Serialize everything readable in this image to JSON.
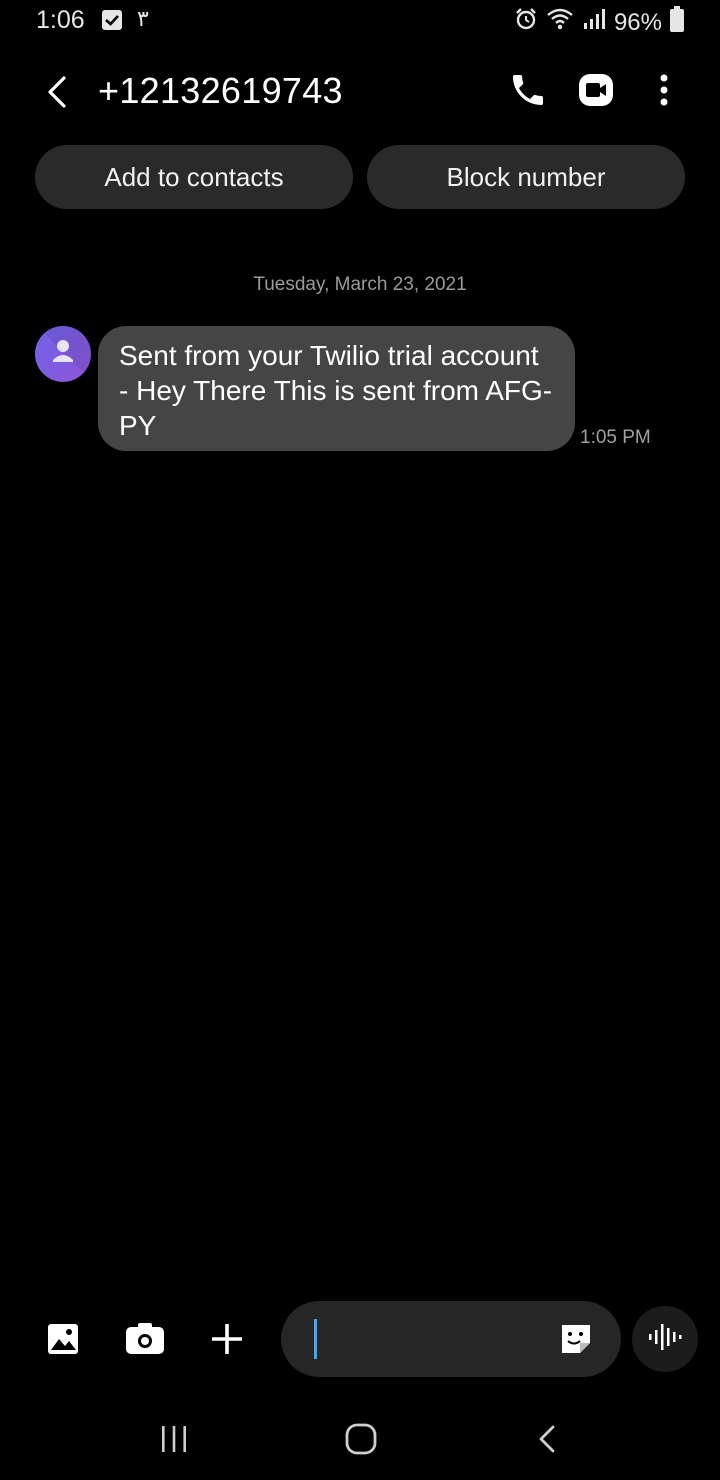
{
  "status_bar": {
    "time": "1:06",
    "extra_indicator": "٣",
    "battery": "96%"
  },
  "header": {
    "title": "+12132619743",
    "icons": [
      "back-icon",
      "phone-icon",
      "video-call-icon",
      "more-vertical-icon"
    ]
  },
  "actions": {
    "add_to_contacts": "Add to contacts",
    "block_number": "Block number"
  },
  "conversation": {
    "date": "Tuesday, March 23, 2021",
    "messages": [
      {
        "text": "Sent from your Twilio trial account - Hey There This is sent from AFG-PY",
        "time": "1:05 PM"
      }
    ]
  },
  "composer": {
    "icons": [
      "gallery-icon",
      "camera-icon",
      "plus-icon",
      "sticker-icon",
      "voice-icon"
    ],
    "input_value": ""
  },
  "nav_bar": {
    "icons": [
      "recent-apps-icon",
      "home-icon",
      "back-nav-icon"
    ]
  },
  "colors": {
    "background": "#000000",
    "bubble": "#454545",
    "pill": "#2a2a2a",
    "avatar": "#7a5fe0",
    "cursor": "#3fa9f5"
  }
}
